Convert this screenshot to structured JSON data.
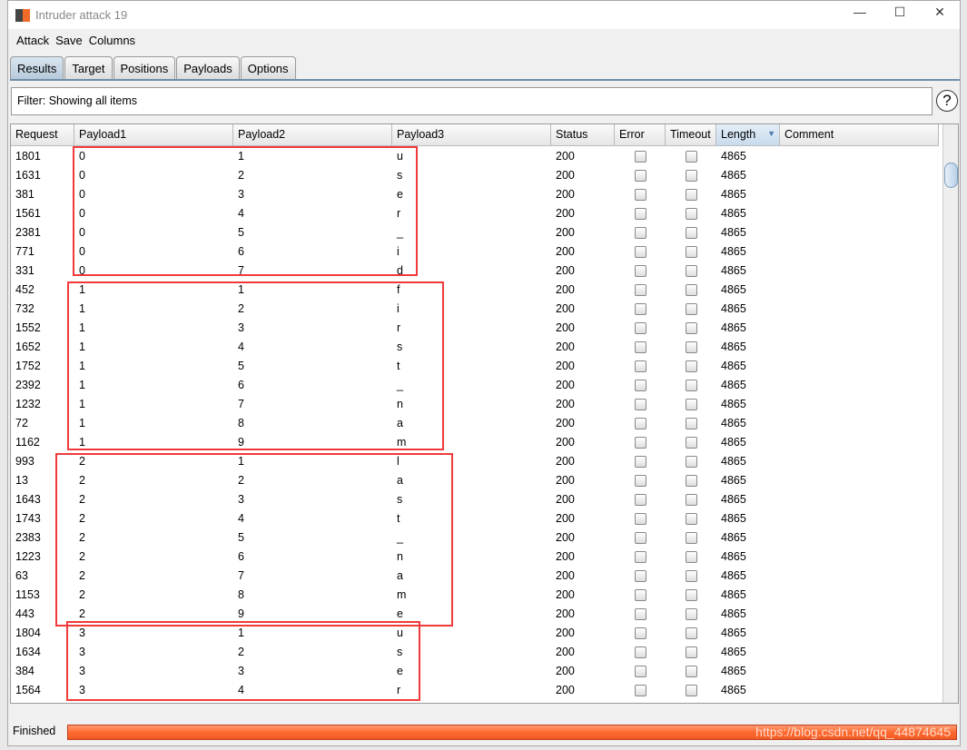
{
  "window": {
    "title": "Intruder attack 19",
    "minimize": "—",
    "maximize": "☐",
    "close": "✕"
  },
  "menu": [
    "Attack",
    "Save",
    "Columns"
  ],
  "tabs": [
    "Results",
    "Target",
    "Positions",
    "Payloads",
    "Options"
  ],
  "active_tab": "Results",
  "filter": "Filter: Showing all items",
  "help": "?",
  "columns": [
    "Request",
    "Payload1",
    "Payload2",
    "Payload3",
    "Status",
    "Error",
    "Timeout",
    "Length",
    "Comment"
  ],
  "sorted_column": "Length",
  "rows": [
    [
      "1801",
      "0",
      "1",
      "u",
      "200",
      "4865"
    ],
    [
      "1631",
      "0",
      "2",
      "s",
      "200",
      "4865"
    ],
    [
      "381",
      "0",
      "3",
      "e",
      "200",
      "4865"
    ],
    [
      "1561",
      "0",
      "4",
      "r",
      "200",
      "4865"
    ],
    [
      "2381",
      "0",
      "5",
      "_",
      "200",
      "4865"
    ],
    [
      "771",
      "0",
      "6",
      "i",
      "200",
      "4865"
    ],
    [
      "331",
      "0",
      "7",
      "d",
      "200",
      "4865"
    ],
    [
      "452",
      "1",
      "1",
      "f",
      "200",
      "4865"
    ],
    [
      "732",
      "1",
      "2",
      "i",
      "200",
      "4865"
    ],
    [
      "1552",
      "1",
      "3",
      "r",
      "200",
      "4865"
    ],
    [
      "1652",
      "1",
      "4",
      "s",
      "200",
      "4865"
    ],
    [
      "1752",
      "1",
      "5",
      "t",
      "200",
      "4865"
    ],
    [
      "2392",
      "1",
      "6",
      "_",
      "200",
      "4865"
    ],
    [
      "1232",
      "1",
      "7",
      "n",
      "200",
      "4865"
    ],
    [
      "72",
      "1",
      "8",
      "a",
      "200",
      "4865"
    ],
    [
      "1162",
      "1",
      "9",
      "m",
      "200",
      "4865"
    ],
    [
      "993",
      "2",
      "1",
      "l",
      "200",
      "4865"
    ],
    [
      "13",
      "2",
      "2",
      "a",
      "200",
      "4865"
    ],
    [
      "1643",
      "2",
      "3",
      "s",
      "200",
      "4865"
    ],
    [
      "1743",
      "2",
      "4",
      "t",
      "200",
      "4865"
    ],
    [
      "2383",
      "2",
      "5",
      "_",
      "200",
      "4865"
    ],
    [
      "1223",
      "2",
      "6",
      "n",
      "200",
      "4865"
    ],
    [
      "63",
      "2",
      "7",
      "a",
      "200",
      "4865"
    ],
    [
      "1153",
      "2",
      "8",
      "m",
      "200",
      "4865"
    ],
    [
      "443",
      "2",
      "9",
      "e",
      "200",
      "4865"
    ],
    [
      "1804",
      "3",
      "1",
      "u",
      "200",
      "4865"
    ],
    [
      "1634",
      "3",
      "2",
      "s",
      "200",
      "4865"
    ],
    [
      "384",
      "3",
      "3",
      "e",
      "200",
      "4865"
    ],
    [
      "1564",
      "3",
      "4",
      "r",
      "200",
      "4865"
    ]
  ],
  "status": "Finished",
  "progress_percent": 100,
  "watermark": "https://blog.csdn.net/qq_44874645",
  "colors": {
    "highlight_box": "#f03a3a",
    "progress": "#ff6a30"
  }
}
